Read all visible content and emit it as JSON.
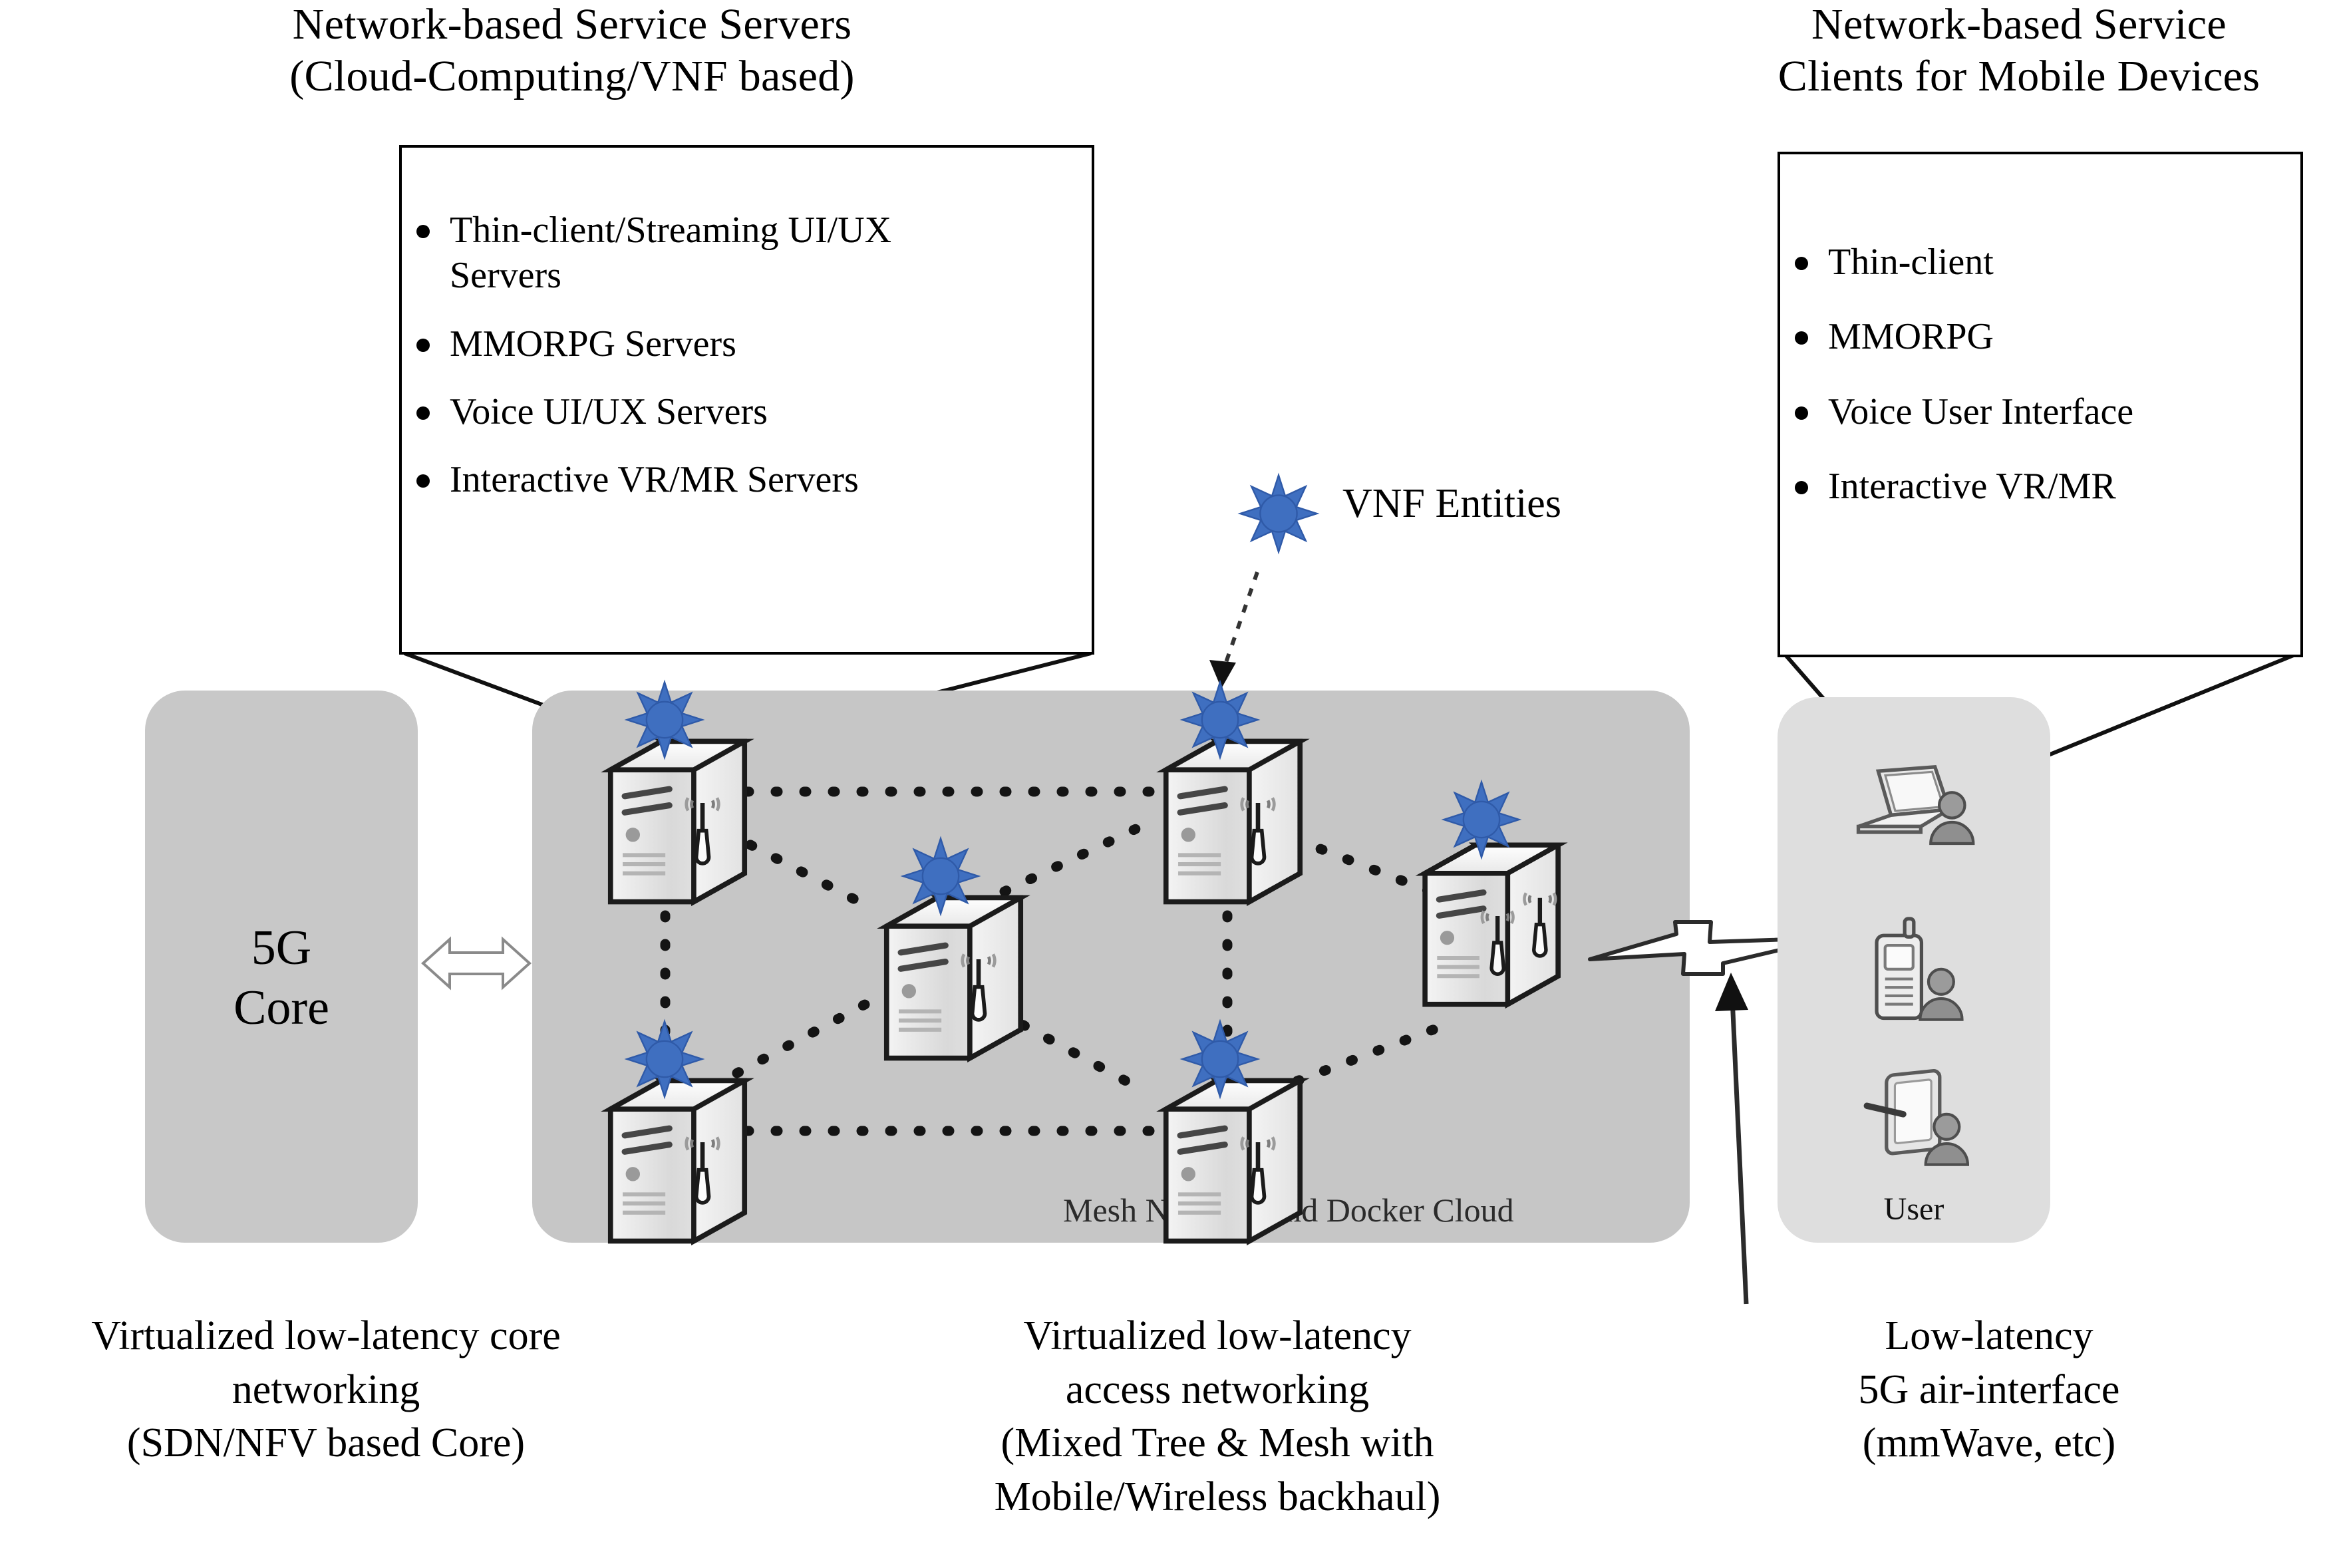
{
  "diagram": {
    "title_left": "Network-based Service Servers",
    "headings": {
      "servers_line1": "Network-based Service Servers",
      "servers_line2": "(Cloud-Computing/VNF based)",
      "clients_line1": "Network-based Service",
      "clients_line2": "Clients for Mobile Devices"
    },
    "server_box": {
      "items": [
        "Thin-client/Streaming  UI/UX Servers",
        "MMORPG Servers",
        "Voice UI/UX  Servers",
        "Interactive  VR/MR Servers"
      ]
    },
    "client_box": {
      "items": [
        "Thin-client",
        "MMORPG",
        "Voice User Interface",
        "Interactive  VR/MR"
      ]
    },
    "legend": {
      "vnf_label": "VNF Entities",
      "vnf_icon": "blue-sunburst-star-icon"
    },
    "core_panel": {
      "line1": "5G",
      "line2": "Core"
    },
    "mesh_panel": {
      "label": "Mesh Network and Docker Cloud"
    },
    "user_panel": {
      "label": "User",
      "devices": [
        "laptop-user-icon",
        "mobile-phone-user-icon",
        "tablet-user-icon"
      ]
    },
    "captions": {
      "core": [
        "Virtualized  low-latency core",
        "networking",
        "(SDN/NFV based Core)"
      ],
      "access": [
        "Virtualized  low-latency",
        "access networking",
        "(Mixed Tree & Mesh with",
        "Mobile/Wireless  backhaul)"
      ],
      "air": [
        "Low-latency",
        "5G air-interface",
        "(mmWave, etc)"
      ]
    },
    "colors": {
      "vnf_blue": "#3f6fc0",
      "vnf_blue_dark": "#2f5aa8",
      "core_panel": "#c8c8c8",
      "mesh_panel": "#c6c6c6",
      "user_panel": "#dedede",
      "line": "#1a1a1a"
    },
    "nodes": [
      {
        "id": "s-tl",
        "name": "server-top-left"
      },
      {
        "id": "s-bl",
        "name": "server-bottom-left"
      },
      {
        "id": "s-c",
        "name": "server-center"
      },
      {
        "id": "s-tr",
        "name": "server-top-right"
      },
      {
        "id": "s-br",
        "name": "server-bottom-right"
      },
      {
        "id": "s-r",
        "name": "server-right-edge"
      }
    ],
    "links": [
      {
        "from": "s-tl",
        "to": "s-tr"
      },
      {
        "from": "s-tl",
        "to": "s-c"
      },
      {
        "from": "s-tl",
        "to": "s-bl"
      },
      {
        "from": "s-c",
        "to": "s-tr"
      },
      {
        "from": "s-c",
        "to": "s-bl"
      },
      {
        "from": "s-c",
        "to": "s-br"
      },
      {
        "from": "s-tr",
        "to": "s-br"
      },
      {
        "from": "s-tr",
        "to": "s-r"
      },
      {
        "from": "s-bl",
        "to": "s-br"
      },
      {
        "from": "s-br",
        "to": "s-r"
      }
    ]
  }
}
